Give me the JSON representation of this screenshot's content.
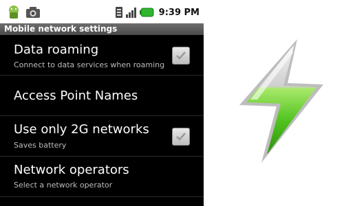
{
  "status_bar": {
    "time": "9:39 PM",
    "icons": [
      "android-usb-icon",
      "camera-icon",
      "sim-icon",
      "signal-icon",
      "battery-icon"
    ]
  },
  "screen": {
    "title": "Mobile network settings",
    "items": [
      {
        "title": "Data roaming",
        "summary": "Connect to data services when roaming",
        "checkbox": true,
        "checked": true
      },
      {
        "title": "Access Point Names",
        "summary": "",
        "checkbox": false
      },
      {
        "title": "Use only 2G networks",
        "summary": "Saves battery",
        "checkbox": true,
        "checked": true
      },
      {
        "title": "Network operators",
        "summary": "Select a network operator",
        "checkbox": false
      }
    ]
  },
  "decoration": {
    "icon": "lightning-bolt-icon",
    "colors": {
      "bolt_green": "#5fcf2a",
      "bolt_silver": "#d9d9d9"
    }
  }
}
